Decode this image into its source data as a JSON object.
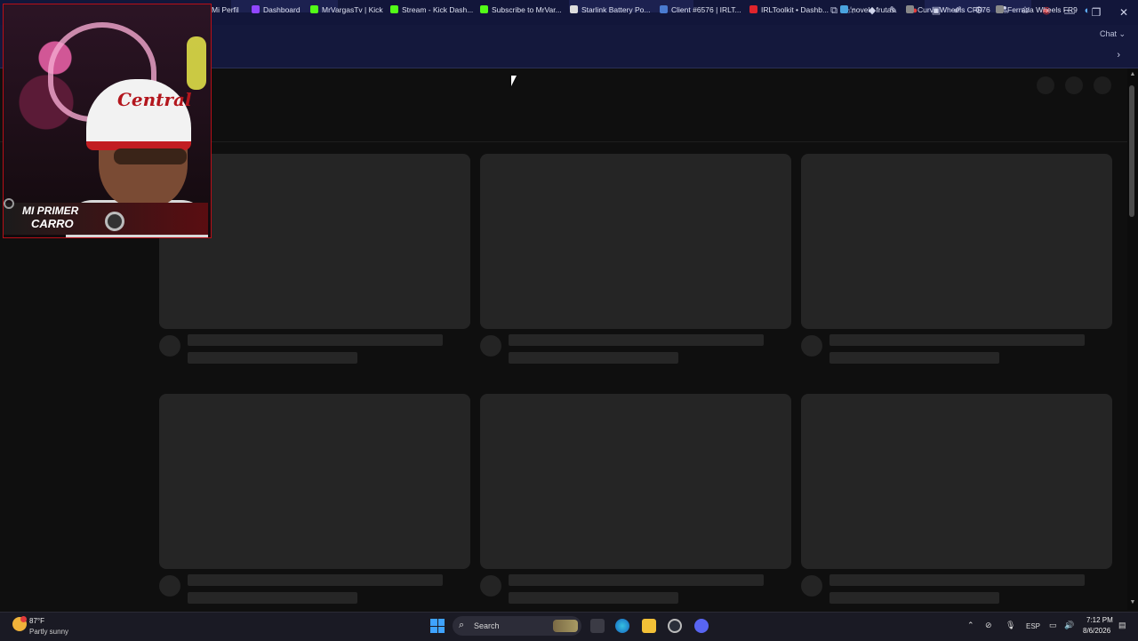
{
  "window": {
    "minimize": "—",
    "maximize": "❐",
    "close": "✕"
  },
  "toolbar": {
    "chat_label": "Chat",
    "icons": [
      "open-in-app-icon",
      "favorite-star-icon",
      "extension-icon",
      "extension-icon",
      "extension-icon",
      "extension-icon",
      "pen-icon",
      "extension-icon",
      "split-screen-icon",
      "favorites-icon",
      "profile-icon",
      "more-icon"
    ]
  },
  "bookmarks": [
    {
      "label": "Mi Perfil",
      "color": "#3a7bd5"
    },
    {
      "label": "Dashboard",
      "color": "#9146ff"
    },
    {
      "label": "MrVargasTv | Kick",
      "color": "#53fc18"
    },
    {
      "label": "Stream - Kick Dash...",
      "color": "#53fc18"
    },
    {
      "label": "Subscribe to MrVar...",
      "color": "#53fc18"
    },
    {
      "label": "Starlink Battery Po...",
      "color": "#dddddd"
    },
    {
      "label": "Client #6576 | IRLT...",
      "color": "#4a7bd0"
    },
    {
      "label": "IRLToolkit • Dashb...",
      "color": "#e0242c"
    },
    {
      "label": "novela frutas",
      "color": "#4aa3df"
    },
    {
      "label": "Curva Wheels CFF76",
      "color": "#888888"
    },
    {
      "label": "Ferrada Wheels FR9",
      "color": "#888888"
    }
  ],
  "overlay": {
    "cap_text": "Central",
    "badge_line1": "MI PRIMER",
    "badge_line2": "CARRO"
  },
  "taskbar": {
    "temperature": "87°F",
    "condition": "Partly sunny",
    "search_label": "Search",
    "language": "ESP",
    "time": "7:12 PM",
    "date": "8/6/2026",
    "apps": [
      "file-explorer-icon",
      "edge-icon",
      "folder-icon",
      "steam-icon",
      "discord-icon"
    ]
  },
  "colors": {
    "titlebar": "#12163a",
    "page_bg": "#0f0f0f",
    "skeleton": "#252525",
    "taskbar": "#1a1a24"
  }
}
